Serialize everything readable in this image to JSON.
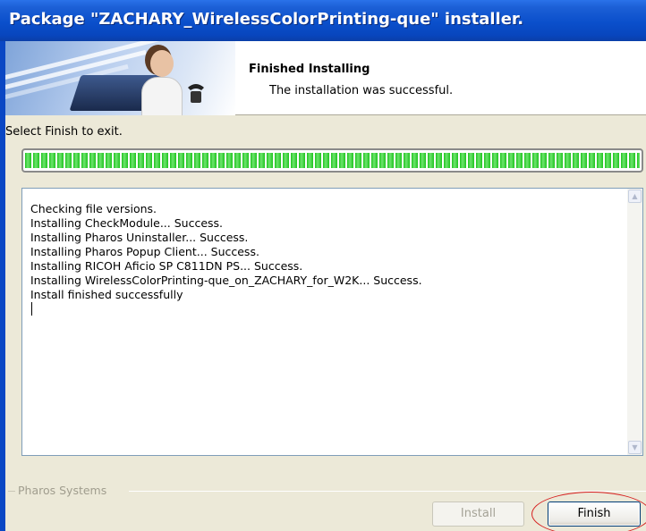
{
  "window": {
    "title": "Package \"ZACHARY_WirelessColorPrinting-que\" installer."
  },
  "header": {
    "title": "Finished Installing",
    "subtitle": "The installation was successful."
  },
  "prompt": "Select Finish to exit.",
  "progress": {
    "fraction": 1.0
  },
  "log": {
    "lines": [
      "Checking file versions.",
      "Installing CheckModule... Success.",
      "Installing Pharos Uninstaller... Success.",
      "Installing Pharos Popup Client... Success.",
      "Installing RICOH Aficio SP C811DN PS... Success.",
      "Installing WirelessColorPrinting-que_on_ZACHARY_for_W2K... Success.",
      "Install finished successfully"
    ]
  },
  "footer": {
    "brand": "Pharos Systems",
    "install_label": "Install",
    "finish_label": "Finish"
  },
  "colors": {
    "progress": "#1fc41f",
    "titlebar": "#0a4fcb",
    "highlight_ring": "#d62020"
  }
}
